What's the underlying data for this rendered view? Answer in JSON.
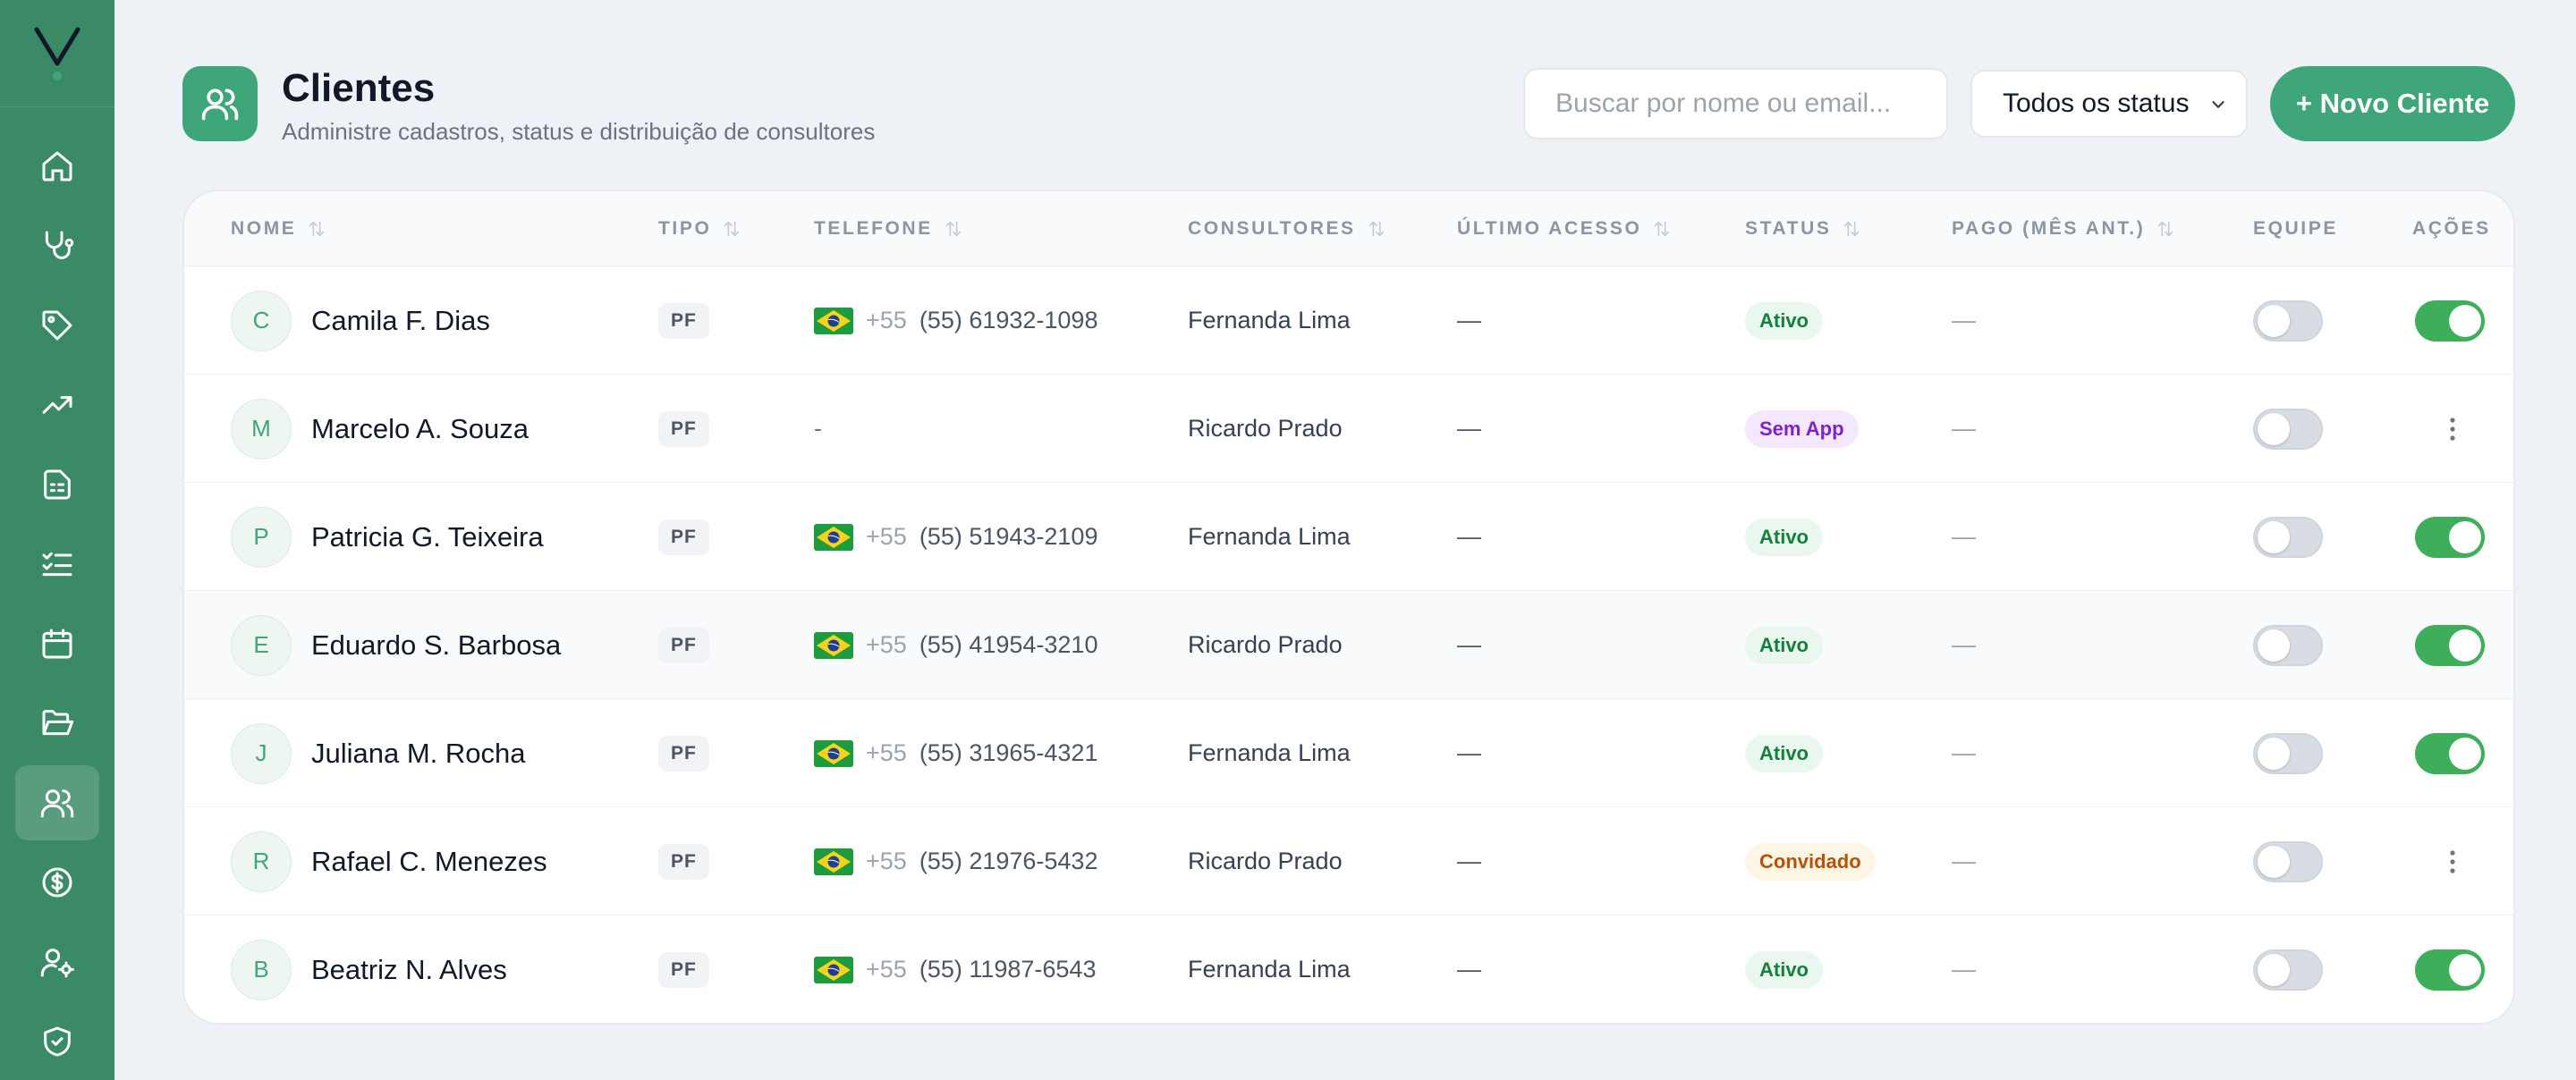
{
  "brand": {
    "logo_letter": "V",
    "accent": "#3a8a66",
    "button_color": "#3fa67a"
  },
  "sidebar": {
    "items": [
      {
        "icon": "home-icon"
      },
      {
        "icon": "stethoscope-icon"
      },
      {
        "icon": "tag-icon"
      },
      {
        "icon": "trending-up-icon"
      },
      {
        "icon": "spreadsheet-icon"
      },
      {
        "icon": "checklist-icon"
      },
      {
        "icon": "calendar-icon"
      },
      {
        "icon": "folder-open-icon"
      },
      {
        "icon": "users-icon",
        "active": true
      },
      {
        "icon": "dollar-circle-icon"
      },
      {
        "icon": "user-settings-icon"
      },
      {
        "icon": "shield-check-icon"
      }
    ]
  },
  "header": {
    "title": "Clientes",
    "subtitle": "Administre cadastros, status e distribuição de consultores",
    "search_placeholder": "Buscar por nome ou email...",
    "status_filter": "Todos os status",
    "new_button": "+ Novo Cliente"
  },
  "table": {
    "columns": {
      "nome": "NOME",
      "tipo": "TIPO",
      "telefone": "TELEFONE",
      "consultores": "CONSULTORES",
      "ultimo_acesso": "ÚLTIMO ACESSO",
      "status": "STATUS",
      "pago": "PAGO (MÊS ANT.)",
      "equipe": "EQUIPE",
      "acoes": "AÇÕES"
    },
    "rows": [
      {
        "initial": "C",
        "name": "Camila F. Dias",
        "type": "PF",
        "has_phone": true,
        "prefix": "+55",
        "phone": "(55) 61932-1098",
        "consultant": "Fernanda Lima",
        "last_access": "—",
        "status": "Ativo",
        "status_kind": "ativo",
        "paid": "—",
        "team": false,
        "action": "toggle-on"
      },
      {
        "initial": "M",
        "name": "Marcelo A. Souza",
        "type": "PF",
        "has_phone": false,
        "phone_empty": "-",
        "consultant": "Ricardo Prado",
        "last_access": "—",
        "status": "Sem App",
        "status_kind": "semapp",
        "paid": "—",
        "team": false,
        "action": "menu"
      },
      {
        "initial": "P",
        "name": "Patricia G. Teixeira",
        "type": "PF",
        "has_phone": true,
        "prefix": "+55",
        "phone": "(55) 51943-2109",
        "consultant": "Fernanda Lima",
        "last_access": "—",
        "status": "Ativo",
        "status_kind": "ativo",
        "paid": "—",
        "team": false,
        "action": "toggle-on"
      },
      {
        "initial": "E",
        "name": "Eduardo S. Barbosa",
        "type": "PF",
        "has_phone": true,
        "prefix": "+55",
        "phone": "(55) 41954-3210",
        "consultant": "Ricardo Prado",
        "last_access": "—",
        "status": "Ativo",
        "status_kind": "ativo",
        "paid": "—",
        "team": false,
        "action": "toggle-on"
      },
      {
        "initial": "J",
        "name": "Juliana M. Rocha",
        "type": "PF",
        "has_phone": true,
        "prefix": "+55",
        "phone": "(55) 31965-4321",
        "consultant": "Fernanda Lima",
        "last_access": "—",
        "status": "Ativo",
        "status_kind": "ativo",
        "paid": "—",
        "team": false,
        "action": "toggle-on"
      },
      {
        "initial": "R",
        "name": "Rafael C. Menezes",
        "type": "PF",
        "has_phone": true,
        "prefix": "+55",
        "phone": "(55) 21976-5432",
        "consultant": "Ricardo Prado",
        "last_access": "—",
        "status": "Convidado",
        "status_kind": "convidado",
        "paid": "—",
        "team": false,
        "action": "menu"
      },
      {
        "initial": "B",
        "name": "Beatriz N. Alves",
        "type": "PF",
        "has_phone": true,
        "prefix": "+55",
        "phone": "(55) 11987-6543",
        "consultant": "Fernanda Lima",
        "last_access": "—",
        "status": "Ativo",
        "status_kind": "ativo",
        "paid": "—",
        "team": false,
        "action": "toggle-on"
      }
    ]
  },
  "status_colors": {
    "ativo": {
      "bg": "#e9f7ee",
      "fg": "#15803d"
    },
    "semapp": {
      "bg": "#f3e8ff",
      "fg": "#7e22ce"
    },
    "convidado": {
      "bg": "#fef6e4",
      "fg": "#b45309"
    }
  }
}
